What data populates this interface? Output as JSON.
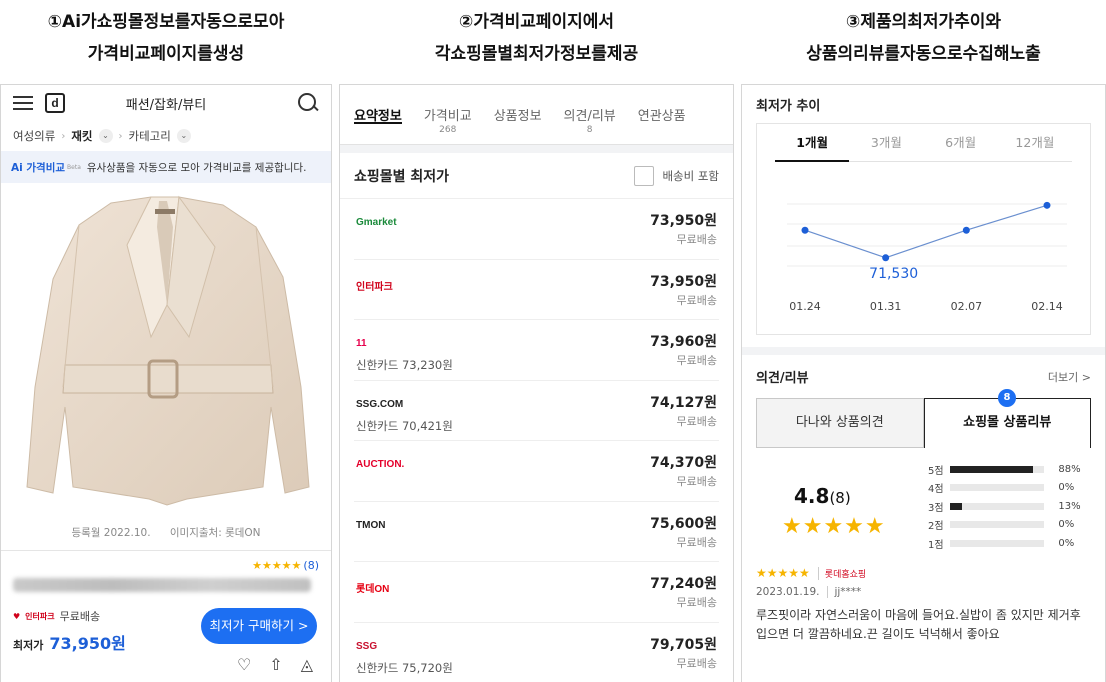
{
  "captions": [
    {
      "line1": "①Ai가쇼핑몰정보를자동으로모아",
      "line2": "가격비교페이지를생성"
    },
    {
      "line1": "②가격비교페이지에서",
      "line2": "각쇼핑몰별최저가정보를제공"
    },
    {
      "line1": "③제품의최저가추이와",
      "line2": "상품의리뷰를자동으로수집해노출"
    }
  ],
  "mobile": {
    "category_title": "패션/잡화/뷰티",
    "logo_letter": "d",
    "breadcrumb": [
      "여성의류",
      "재킷",
      "카테고리"
    ],
    "ai_label": "Ai 가격비교",
    "ai_beta": "Beta",
    "ai_notice": "유사상품을 자동으로 모아 가격비교를 제공합니다.",
    "registered": "등록월 2022.10.",
    "image_source": "이미지출처: 롯데ON",
    "review_count": "(8)",
    "mall_name": "인터파크",
    "shipping": "무료배송",
    "lowest_label": "최저가",
    "lowest_price": "73,950원",
    "buy_button": "최저가 구매하기 >"
  },
  "compare": {
    "tabs": [
      {
        "label": "요약정보",
        "sub": ""
      },
      {
        "label": "가격비교",
        "sub": "268"
      },
      {
        "label": "상품정보",
        "sub": ""
      },
      {
        "label": "의견/리뷰",
        "sub": "8"
      },
      {
        "label": "연관상품",
        "sub": ""
      }
    ],
    "section_title": "쇼핑몰별 최저가",
    "include_shipping": "배송비 포함",
    "malls": [
      {
        "name": "Gmarket",
        "color": "#1a8a3a",
        "card": "",
        "price": "73,950원",
        "shipping": "무료배송"
      },
      {
        "name": "인터파크",
        "color": "#d0021b",
        "card": "",
        "price": "73,950원",
        "shipping": "무료배송"
      },
      {
        "name": "11",
        "color": "#e6004c",
        "card": "신한카드 73,230원",
        "price": "73,960원",
        "shipping": "무료배송"
      },
      {
        "name": "SSG.COM",
        "color": "#222222",
        "card": "신한카드 70,421원",
        "price": "74,127원",
        "shipping": "무료배송"
      },
      {
        "name": "AUCTION.",
        "color": "#e4002b",
        "card": "",
        "price": "74,370원",
        "shipping": "무료배송"
      },
      {
        "name": "TMON",
        "color": "#222222",
        "card": "",
        "price": "75,600원",
        "shipping": "무료배송"
      },
      {
        "name": "롯데ON",
        "color": "#e60012",
        "card": "",
        "price": "77,240원",
        "shipping": "무료배송"
      },
      {
        "name": "SSG",
        "color": "#c8102e",
        "card": "신한카드 75,720원",
        "price": "79,705원",
        "shipping": "무료배송"
      }
    ]
  },
  "trend": {
    "title": "최저가 추이",
    "periods": [
      "1개월",
      "3개월",
      "6개월",
      "12개월"
    ],
    "active_period": "1개월",
    "dates": [
      "01.24",
      "01.31",
      "02.07",
      "02.14"
    ],
    "values": [
      73300,
      71530,
      73300,
      74900
    ],
    "highlight_label": "71,530"
  },
  "reviews": {
    "title": "의견/리뷰",
    "more": "더보기 >",
    "tabs": [
      "다나와 상품의견",
      "쇼핑몰 상품리뷰"
    ],
    "badge": "8",
    "score": "4.8",
    "count": "(8)",
    "distribution": [
      {
        "label": "5점",
        "pct": 88,
        "text": "88%"
      },
      {
        "label": "4점",
        "pct": 0,
        "text": "0%"
      },
      {
        "label": "3점",
        "pct": 13,
        "text": "13%"
      },
      {
        "label": "2점",
        "pct": 0,
        "text": "0%"
      },
      {
        "label": "1점",
        "pct": 0,
        "text": "0%"
      }
    ],
    "item": {
      "shop": "롯데홈쇼핑",
      "date": "2023.01.19.",
      "user": "jj****",
      "text": "루즈핏이라 자연스러움이 마음에 들어요.실밥이 좀 있지만 제거후 입으면 더 깔끔하네요.끈 길이도 넉넉해서 좋아요"
    }
  }
}
